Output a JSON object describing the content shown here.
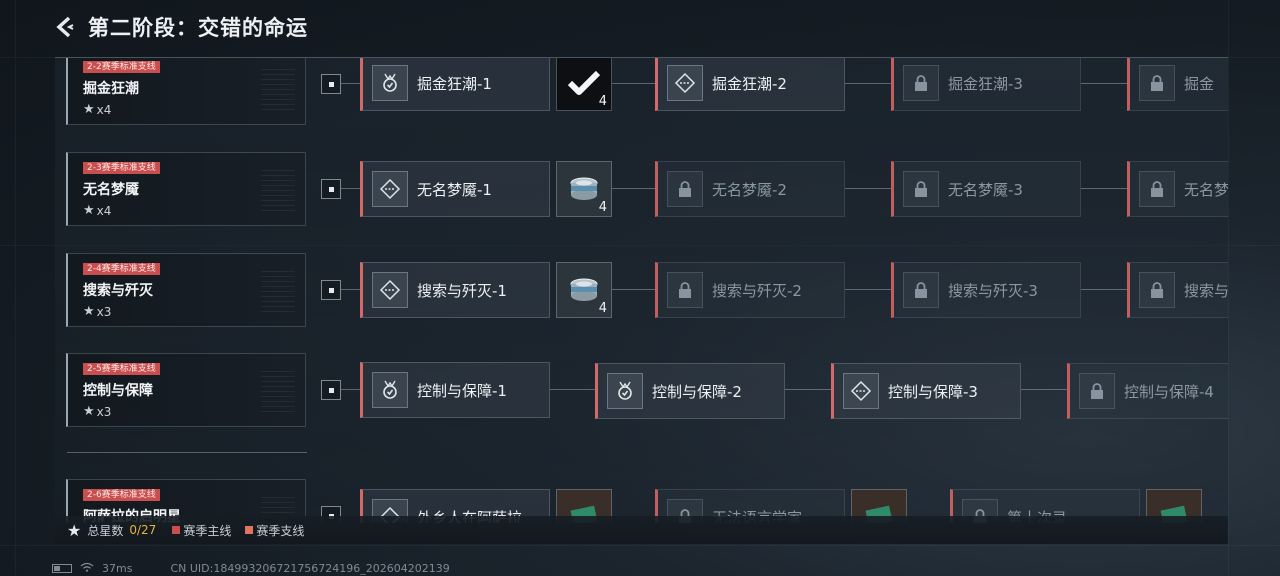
{
  "header": {
    "title": "第二阶段：交错的命运"
  },
  "stages": [
    {
      "tag": "2-2赛季标准支线",
      "name": "掘金狂潮",
      "stars": "x4",
      "levels": [
        {
          "name": "掘金狂潮-1",
          "icon": "medal-icon",
          "locked": false
        },
        {
          "name": "掘金狂潮-2",
          "icon": "diamond-icon",
          "locked": false
        },
        {
          "name": "掘金狂潮-3",
          "icon": "lock-icon",
          "locked": true
        },
        {
          "name": "掘金",
          "icon": "lock-icon",
          "locked": true
        }
      ],
      "reward": {
        "icon": "checkmark-icon",
        "count": "4"
      }
    },
    {
      "tag": "2-3赛季标准支线",
      "name": "无名梦魇",
      "stars": "x4",
      "levels": [
        {
          "name": "无名梦魇-1",
          "icon": "diamond-icon",
          "locked": false
        },
        {
          "name": "无名梦魇-2",
          "icon": "lock-icon",
          "locked": true
        },
        {
          "name": "无名梦魇-3",
          "icon": "lock-icon",
          "locked": true
        },
        {
          "name": "无名梦",
          "icon": "lock-icon",
          "locked": true
        }
      ],
      "reward": {
        "icon": "tin-can-icon",
        "count": "4"
      }
    },
    {
      "tag": "2-4赛季标准支线",
      "name": "搜索与歼灭",
      "stars": "x3",
      "levels": [
        {
          "name": "搜索与歼灭-1",
          "icon": "diamond-icon",
          "locked": false
        },
        {
          "name": "搜索与歼灭-2",
          "icon": "lock-icon",
          "locked": true
        },
        {
          "name": "搜索与歼灭-3",
          "icon": "lock-icon",
          "locked": true
        },
        {
          "name": "搜索与",
          "icon": "lock-icon",
          "locked": true
        }
      ],
      "reward": {
        "icon": "tin-can-icon",
        "count": "4"
      }
    },
    {
      "tag": "2-5赛季标准支线",
      "name": "控制与保障",
      "stars": "x3",
      "levels": [
        {
          "name": "控制与保障-1",
          "icon": "medal-icon",
          "locked": false
        },
        {
          "name": "控制与保障-2",
          "icon": "medal-icon",
          "locked": false
        },
        {
          "name": "控制与保障-3",
          "icon": "diamond-icon",
          "locked": false
        },
        {
          "name": "控制与保障-4",
          "icon": "lock-icon",
          "locked": true
        }
      ]
    },
    {
      "tag": "2-6赛季标准支线",
      "name": "阿萨拉的启明星",
      "levels": [
        {
          "name": "外乡人在阿萨拉",
          "icon": "diamond-icon",
          "locked": false
        },
        {
          "name": "无法语言学家",
          "icon": "lock-icon",
          "locked": true
        },
        {
          "name": "第十次录",
          "icon": "lock-icon",
          "locked": true
        }
      ]
    }
  ],
  "legend": {
    "total_label": "总星数",
    "total_value": "0/27",
    "main_label": "赛季主线",
    "branch_label": "赛季支线",
    "main_color": "#c94e4e",
    "branch_color": "#e0745e"
  },
  "status": {
    "ping": "37ms",
    "uid": "CN UID:18499320672175672419­6_202604202139"
  }
}
